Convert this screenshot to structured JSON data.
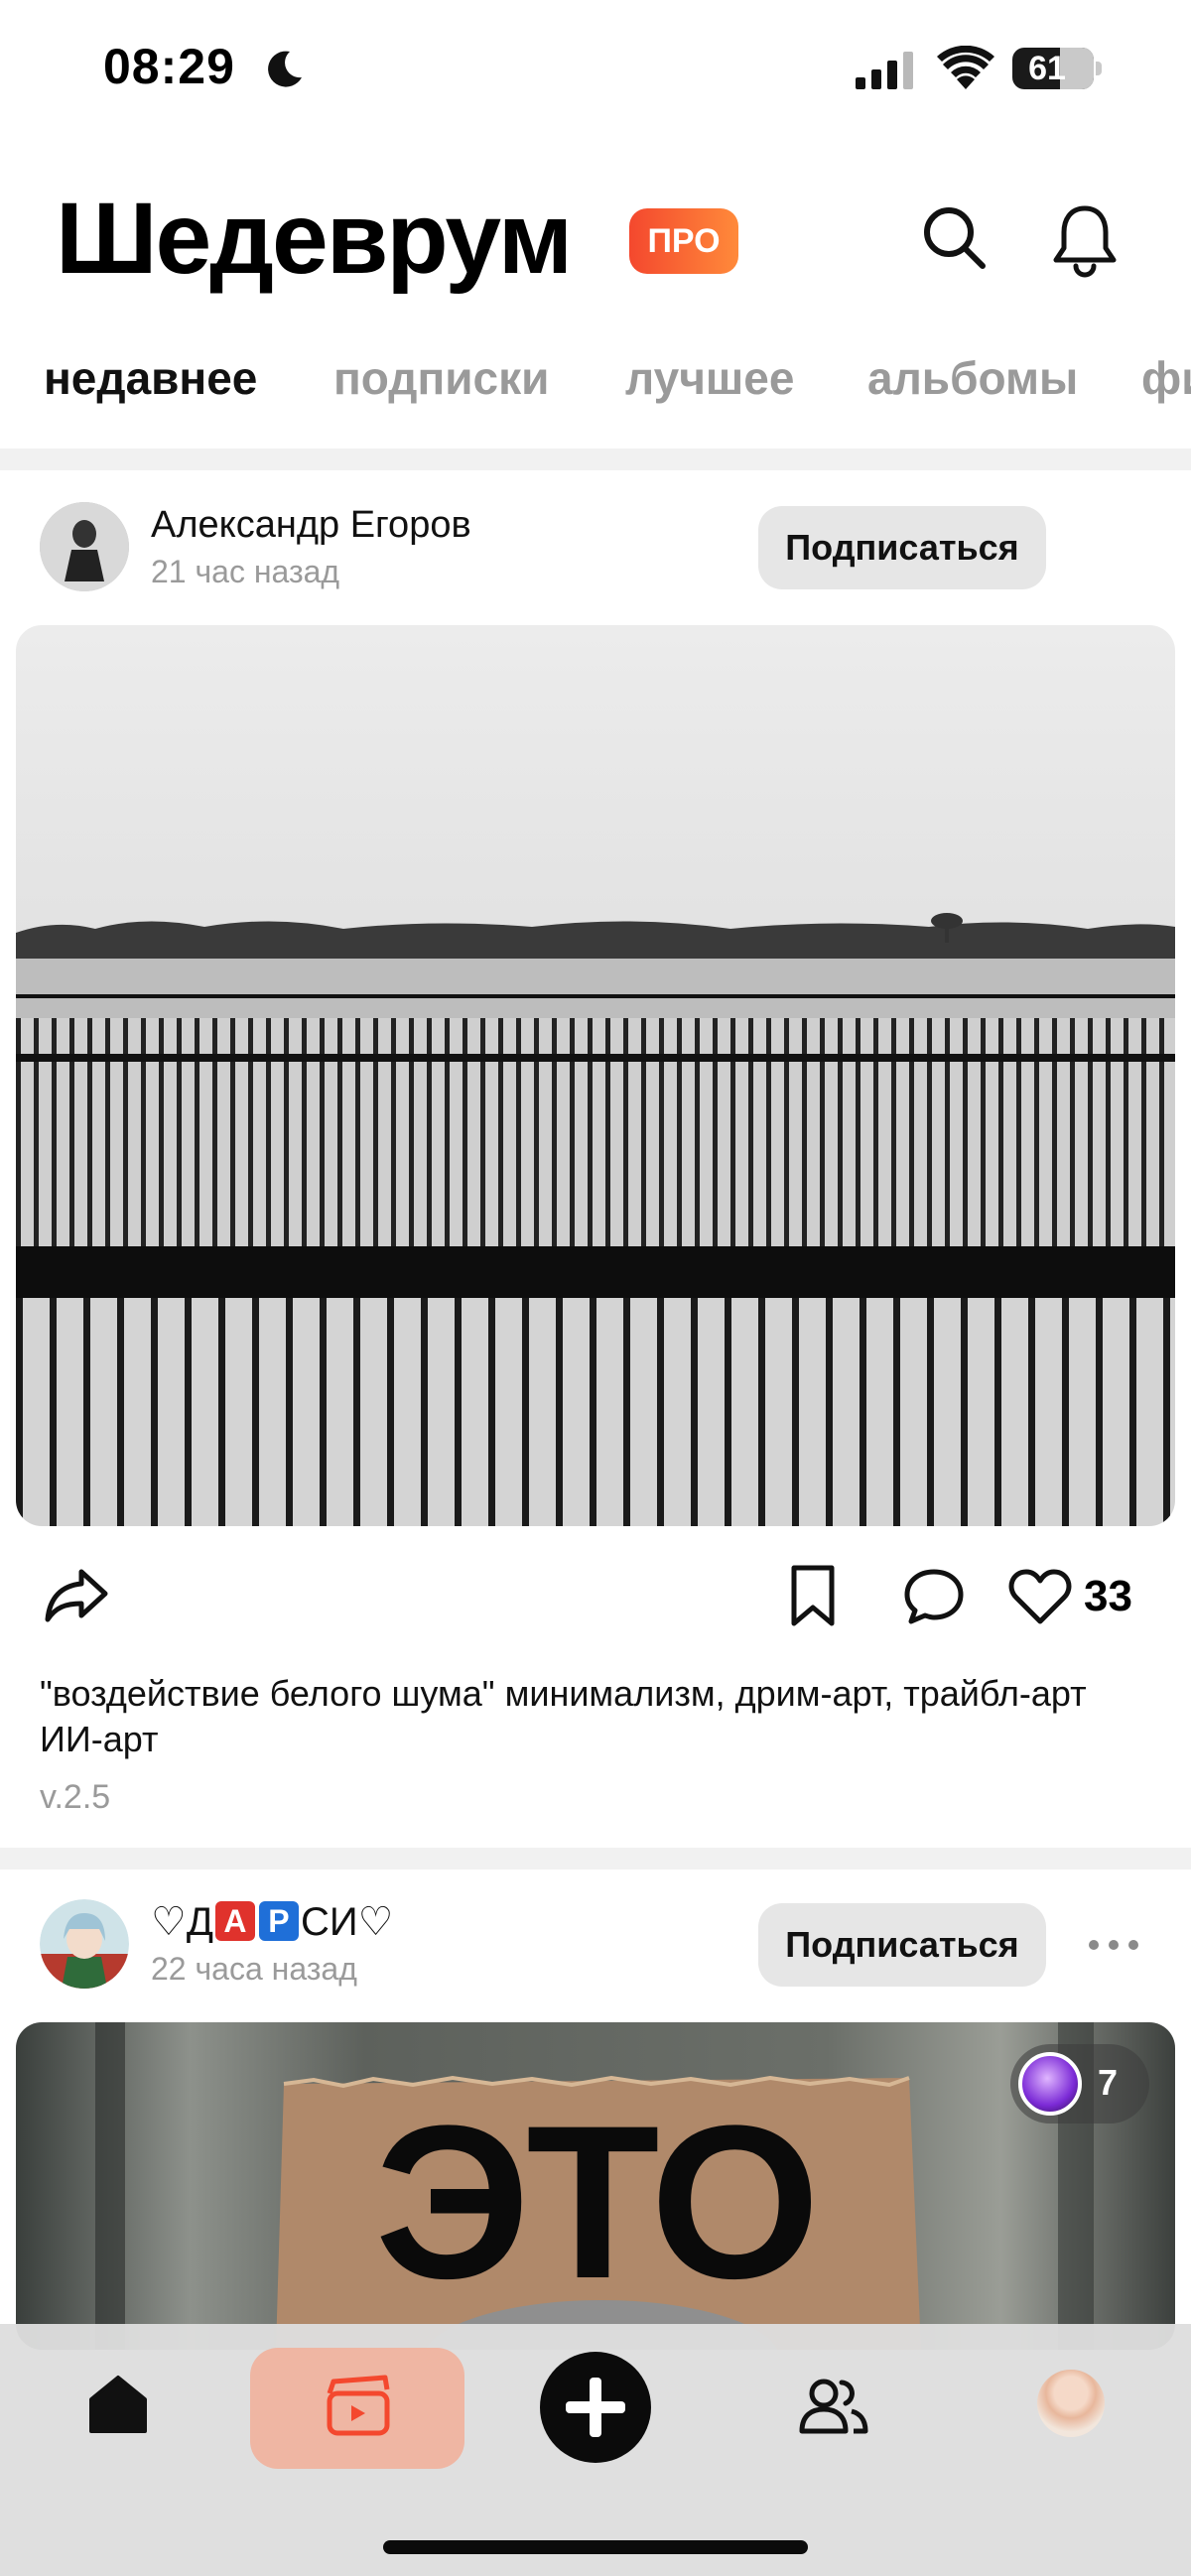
{
  "status_bar": {
    "time": "08:29",
    "battery": "61"
  },
  "header": {
    "title": "Шедеврум",
    "badge": "ПРО"
  },
  "tabs": [
    {
      "label": "недавнее",
      "active": true
    },
    {
      "label": "подписки",
      "active": false
    },
    {
      "label": "лучшее",
      "active": false
    },
    {
      "label": "альбомы",
      "active": false
    },
    {
      "label": "фи",
      "active": false
    }
  ],
  "posts": [
    {
      "author": "Александр Егоров",
      "time": "21 час назад",
      "subscribe_label": "Подписаться",
      "likes": "33",
      "caption": "\"воздействие белого шума\" минимализм,  дрим-арт, трайбл-арт ИИ-арт",
      "version": "v.2.5"
    },
    {
      "author_prefix": "♡Д",
      "author_badge_a": "A",
      "author_badge_p": "P",
      "author_suffix": "СИ♡",
      "time": "22 часа назад",
      "subscribe_label": "Подписаться",
      "image_text": "ЭТО",
      "album_count": "7"
    }
  ],
  "colors": {
    "accent": "#f4482e",
    "subscribe_bg": "#e6e6e6",
    "reels_active_bg": "#efb6a3",
    "muted_text": "#9a9a9a"
  },
  "icons": [
    "moon-icon",
    "signal-icon",
    "wifi-icon",
    "search-icon",
    "bell-icon",
    "share-icon",
    "bookmark-icon",
    "comment-icon",
    "heart-icon",
    "more-icon",
    "home-icon",
    "reels-icon",
    "plus-icon",
    "people-icon"
  ]
}
